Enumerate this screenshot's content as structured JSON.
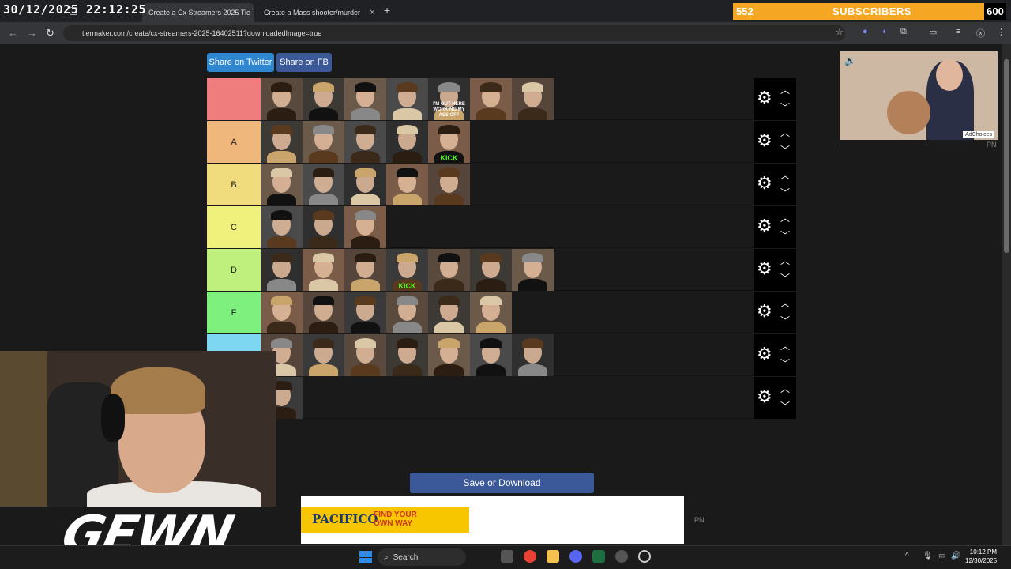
{
  "overlay": {
    "datetime": "30/12/2025 22:12:25",
    "subscriber_count": "552",
    "subscriber_label": "SUBSCRIBERS",
    "subscriber_goal": "600",
    "streamer_logo": "GEWN"
  },
  "browser": {
    "tabs": [
      {
        "label": "Create a Cx Streamers 2025 Tie",
        "active": true
      },
      {
        "label": "Create a Mass shooter/murder",
        "active": false
      }
    ],
    "url": "tiermaker.com/create/cx-streamers-2025-16402511?downloadedImage=true"
  },
  "page": {
    "share_twitter": "Share on Twitter",
    "share_fb": "Share on FB",
    "save_button": "Save or Download",
    "tiers": [
      {
        "label": "",
        "color": "#f07d7d",
        "count": 7
      },
      {
        "label": "A",
        "color": "#f0b77d",
        "count": 5
      },
      {
        "label": "B",
        "color": "#f0db7d",
        "count": 5
      },
      {
        "label": "C",
        "color": "#f0f07d",
        "count": 3
      },
      {
        "label": "D",
        "color": "#bff07d",
        "count": 7
      },
      {
        "label": "F",
        "color": "#7df07d",
        "count": 6
      },
      {
        "label": "",
        "color": "#7dd7f0",
        "count": 7
      },
      {
        "label": "",
        "color": "#1a1a1a",
        "count": 1
      }
    ],
    "thumb_text": {
      "0_4": "I'M OUT HERE WORKING MY ASS OFF",
      "1_4": "KICK",
      "4_3": "KICK"
    }
  },
  "ads": {
    "right_choices": "AdChoices",
    "right_pn": "PN",
    "bottom_brand": "PACIFICO",
    "bottom_tagline": "FIND YOUR OWN WAY",
    "bottom_pn": "PN"
  },
  "taskbar": {
    "search_label": "Search",
    "time": "10:12 PM",
    "date": "12/30/2025"
  }
}
